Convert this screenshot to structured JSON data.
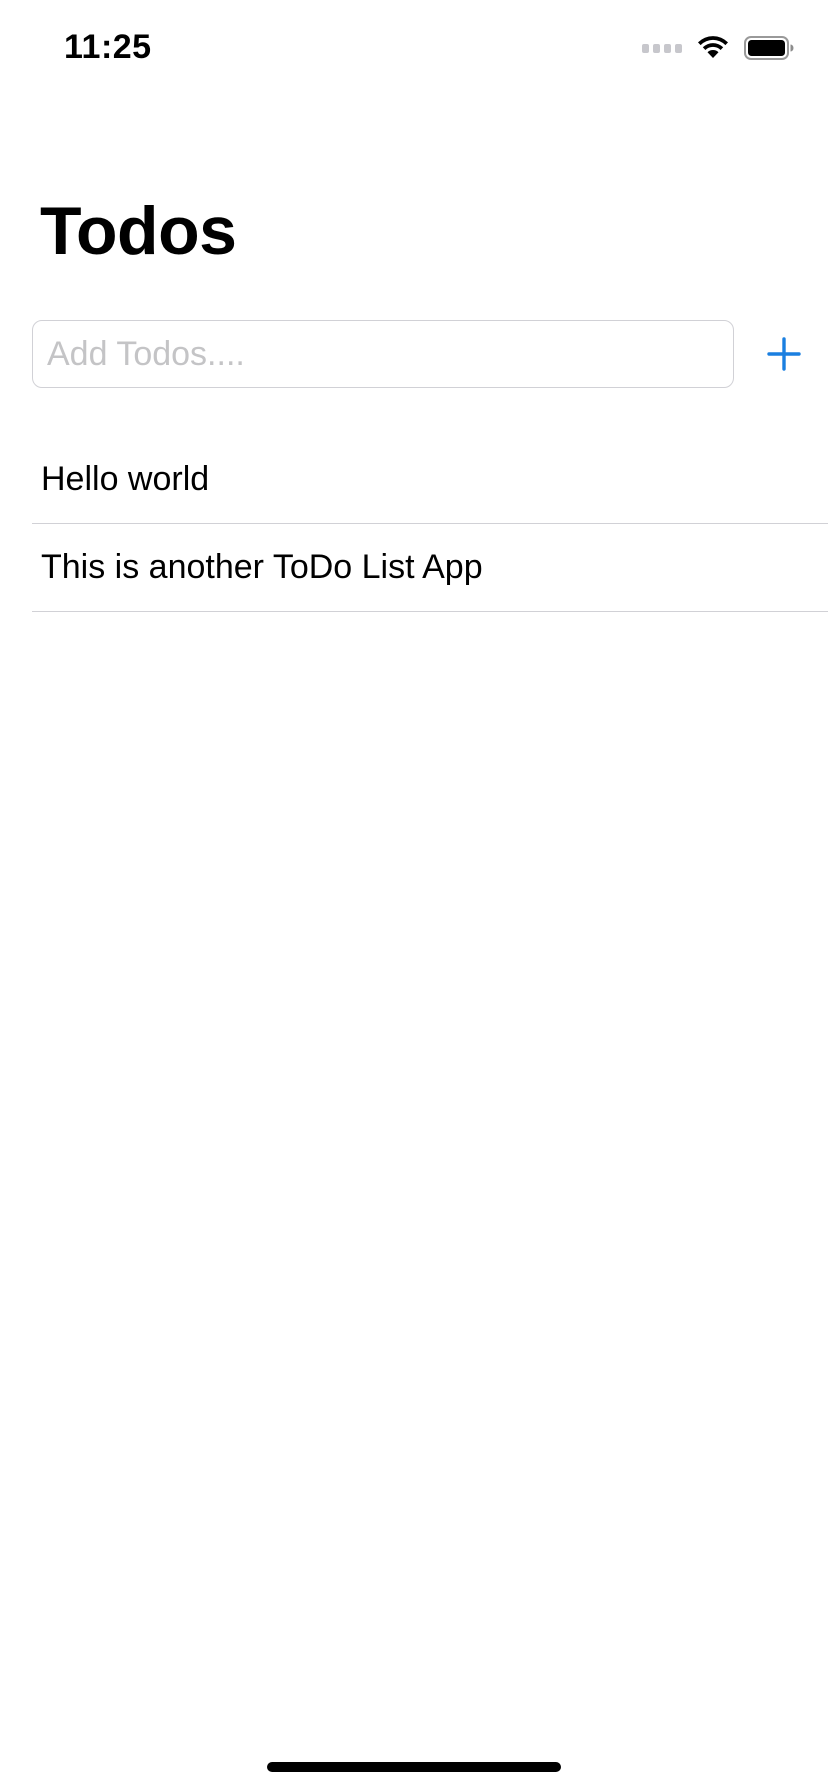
{
  "status_bar": {
    "time": "11:25",
    "icons": [
      "cellular-signal-icon",
      "wifi-icon",
      "battery-icon"
    ]
  },
  "screen": {
    "title": "Todos"
  },
  "add_todo": {
    "input_value": "",
    "placeholder": "Add Todos....",
    "add_button_icon": "plus-icon",
    "accent_color": "#1a7fe0"
  },
  "todos": [
    {
      "text": "Hello world"
    },
    {
      "text": "This is another ToDo List App"
    }
  ]
}
